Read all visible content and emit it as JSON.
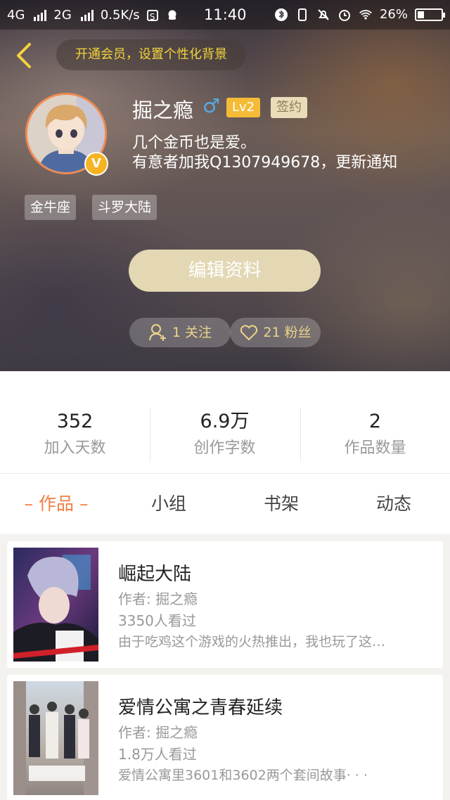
{
  "status_bar": {
    "net1": "4G",
    "net2": "2G",
    "speed": "0.5K/s",
    "s_icon": "S",
    "time": "11:40",
    "battery": "26%",
    "battery_level": 0.26
  },
  "header": {
    "vip_banner": "开通会员，设置个性化背景"
  },
  "profile": {
    "name": "掘之瘾",
    "gender_symbol": "♂",
    "level": "Lv2",
    "sign_badge": "签约",
    "bio_line1": "几个金币也是爱。",
    "bio_line2": "有意者加我Q1307949678，更新通知",
    "v_badge": "V",
    "tags": [
      "金牛座",
      "斗罗大陆"
    ],
    "edit_button": "编辑资料",
    "following": "1 关注",
    "fans": "21 粉丝"
  },
  "stats": [
    {
      "value": "352",
      "label": "加入天数"
    },
    {
      "value": "6.9万",
      "label": "创作字数"
    },
    {
      "value": "2",
      "label": "作品数量"
    }
  ],
  "tabs": [
    "– 作品 –",
    "小组",
    "书架",
    "动态"
  ],
  "books": [
    {
      "title": "崛起大陆",
      "author": "作者: 掘之瘾",
      "views": "3350人看过",
      "desc": "由于吃鸡这个游戏的火热推出，我也玩了这…"
    },
    {
      "title": "爱情公寓之青春延续",
      "author": "作者: 掘之瘾",
      "views": "1.8万人看过",
      "desc": "爱情公寓里3601和3602两个套间故事· · ·"
    }
  ],
  "colors": {
    "accent": "#f07e45",
    "gold": "#f4d33a",
    "level": "#f4bb37"
  }
}
